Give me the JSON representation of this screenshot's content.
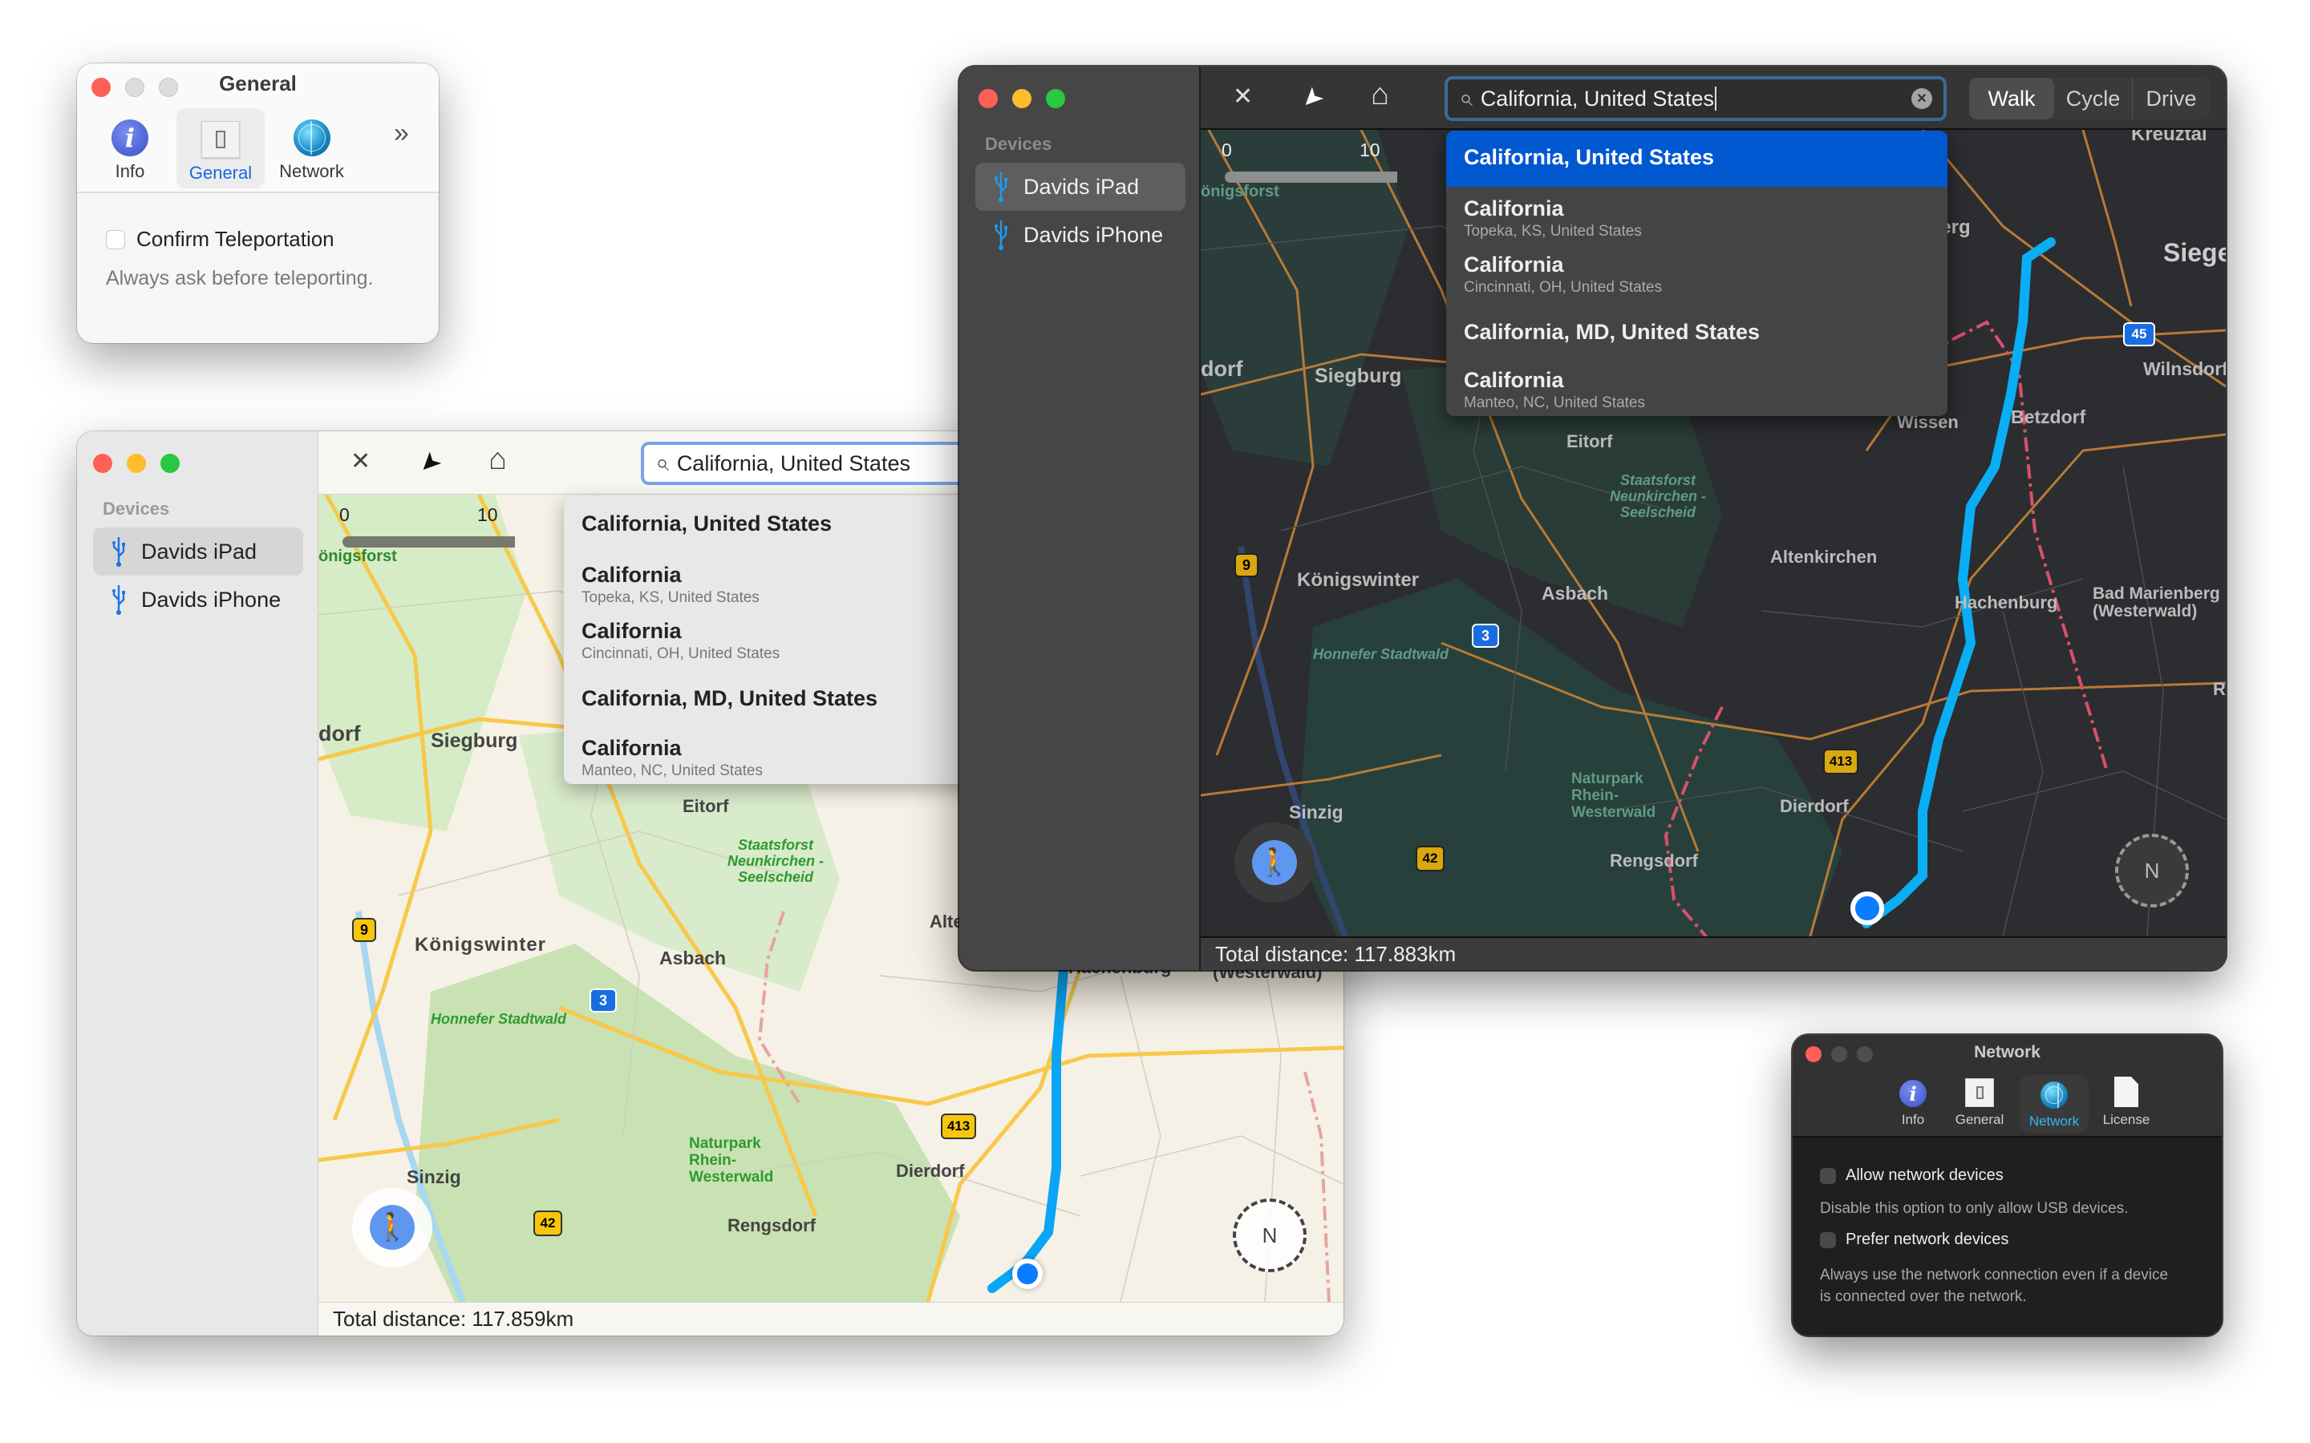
{
  "general_window": {
    "title": "General",
    "tabs": [
      {
        "label": "Info",
        "icon": "info-icon",
        "selected": false
      },
      {
        "label": "General",
        "icon": "switch-icon",
        "selected": true
      },
      {
        "label": "Network",
        "icon": "globe-icon",
        "selected": false
      }
    ],
    "overflow_icon": "»",
    "option": {
      "label": "Confirm Teleportation",
      "checked": false,
      "description": "Always ask before teleporting."
    }
  },
  "light_window": {
    "sidebar": {
      "section": "Devices",
      "devices": [
        {
          "name": "Davids iPad",
          "selected": true
        },
        {
          "name": "Davids iPhone",
          "selected": false
        }
      ]
    },
    "toolbar": {
      "close_icon": "✕",
      "location_icon": "➤",
      "home_icon": "⌂"
    },
    "search": {
      "value": "California, United States",
      "icon": "⌕"
    },
    "results": [
      {
        "title": "California, United States",
        "subtitle": ""
      },
      {
        "title": "California",
        "subtitle": "Topeka, KS, United States"
      },
      {
        "title": "California",
        "subtitle": "Cincinnati, OH, United States"
      },
      {
        "title": "California, MD, United States",
        "subtitle": ""
      },
      {
        "title": "California",
        "subtitle": "Manteo, NC, United States"
      }
    ],
    "scale": {
      "start": "0",
      "mid": "10"
    },
    "map_labels": [
      "Siegburg",
      "Eitorf",
      "Staatsforst Neunkirchen - Seelscheid",
      "Königswinter",
      "Asbach",
      "Altenkirchen",
      "Honnefer Stadtwald",
      "Naturpark Rhein-Westerwald",
      "Sinzig",
      "Dierdorf",
      "Rengsdorf",
      "Hachenburg",
      "(Westerwald)",
      "önigsforst",
      "dorf"
    ],
    "shields": [
      "9",
      "3",
      "413",
      "42"
    ],
    "compass_label": "N",
    "status": "Total distance: 117.859km"
  },
  "dark_window": {
    "sidebar": {
      "section": "Devices",
      "devices": [
        {
          "name": "Davids iPad",
          "selected": true
        },
        {
          "name": "Davids iPhone",
          "selected": false
        }
      ]
    },
    "toolbar": {
      "close_icon": "✕",
      "location_icon": "➤",
      "home_icon": "⌂"
    },
    "search": {
      "value": "California, United States",
      "icon": "⌕",
      "clear_icon": "✕"
    },
    "modes": [
      {
        "label": "Walk",
        "selected": true
      },
      {
        "label": "Cycle",
        "selected": false
      },
      {
        "label": "Drive",
        "selected": false
      }
    ],
    "results": [
      {
        "title": "California, United States",
        "subtitle": "",
        "highlighted": true
      },
      {
        "title": "California",
        "subtitle": "Topeka, KS, United States"
      },
      {
        "title": "California",
        "subtitle": "Cincinnati, OH, United States"
      },
      {
        "title": "California, MD, United States",
        "subtitle": ""
      },
      {
        "title": "California",
        "subtitle": "Manteo, NC, United States"
      }
    ],
    "scale": {
      "start": "0",
      "mid": "10"
    },
    "map_labels": [
      "Kreuztal",
      "nberg",
      "Siege",
      "Wilnsdorf",
      "Betzdorf",
      "Wissen",
      "Eitorf",
      "Staatsforst Neunkirchen - Seelscheid",
      "Siegburg",
      "dorf",
      "Altenkirchen",
      "Königswinter",
      "Asbach",
      "Hachenburg",
      "Bad Marienberg (Westerwald)",
      "Honnefer Stadtwald",
      "Naturpark Rhein-Westerwald",
      "Sinzig",
      "Dierdorf",
      "Rengsdorf",
      "önigsforst",
      "Re"
    ],
    "shields": [
      "45",
      "9",
      "3",
      "413",
      "42"
    ],
    "compass_label": "N",
    "status": "Total distance: 117.883km"
  },
  "network_window": {
    "title": "Network",
    "tabs": [
      {
        "label": "Info",
        "selected": false
      },
      {
        "label": "General",
        "selected": false
      },
      {
        "label": "Network",
        "selected": true
      },
      {
        "label": "License",
        "selected": false
      }
    ],
    "options": [
      {
        "label": "Allow network devices",
        "checked": false,
        "description": "Disable this option to only allow USB devices."
      },
      {
        "label": "Prefer network devices",
        "checked": false,
        "description": "Always use the network connection even if a device is connected over the network."
      }
    ]
  },
  "colors": {
    "accent": "#1769e0",
    "route": "#0aa5f5",
    "highlight": "#0058d0",
    "location_dot": "#0a7cff"
  }
}
